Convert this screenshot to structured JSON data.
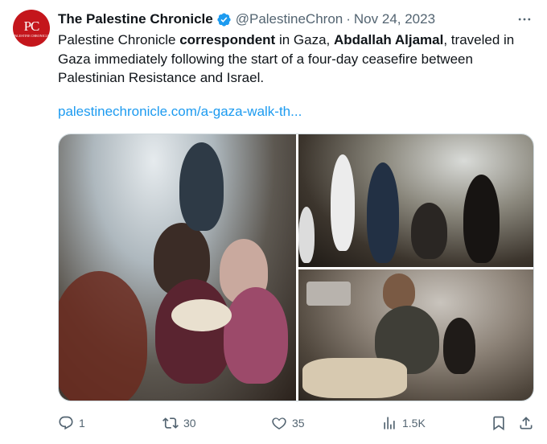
{
  "account": {
    "avatar_text": "PC",
    "avatar_subtext": "Palestine Chronicle",
    "name": "The Palestine Chronicle",
    "handle": "@PalestineChron",
    "separator": "·",
    "date": "Nov 24, 2023"
  },
  "tweet": {
    "part1": "Palestine Chronicle ",
    "bold1": "correspondent",
    "part2": " in Gaza, ",
    "bold2": "Abdallah Aljamal",
    "part3": ", traveled in Gaza immediately following the start of a four-day ceasefire between Palestinian Resistance and Israel.",
    "link": "palestinechronicle.com/a-gaza-walk-th..."
  },
  "actions": {
    "replies": "1",
    "reposts": "30",
    "likes": "35",
    "views": "1.5K"
  },
  "colors": {
    "brand_red": "#c4161c",
    "verified_blue": "#1d9bf0",
    "link_blue": "#1d9bf0",
    "secondary_text": "#536471"
  },
  "icons": [
    "more-icon",
    "verified-badge-icon",
    "reply-icon",
    "repost-icon",
    "like-icon",
    "views-icon",
    "bookmark-icon",
    "share-icon"
  ]
}
